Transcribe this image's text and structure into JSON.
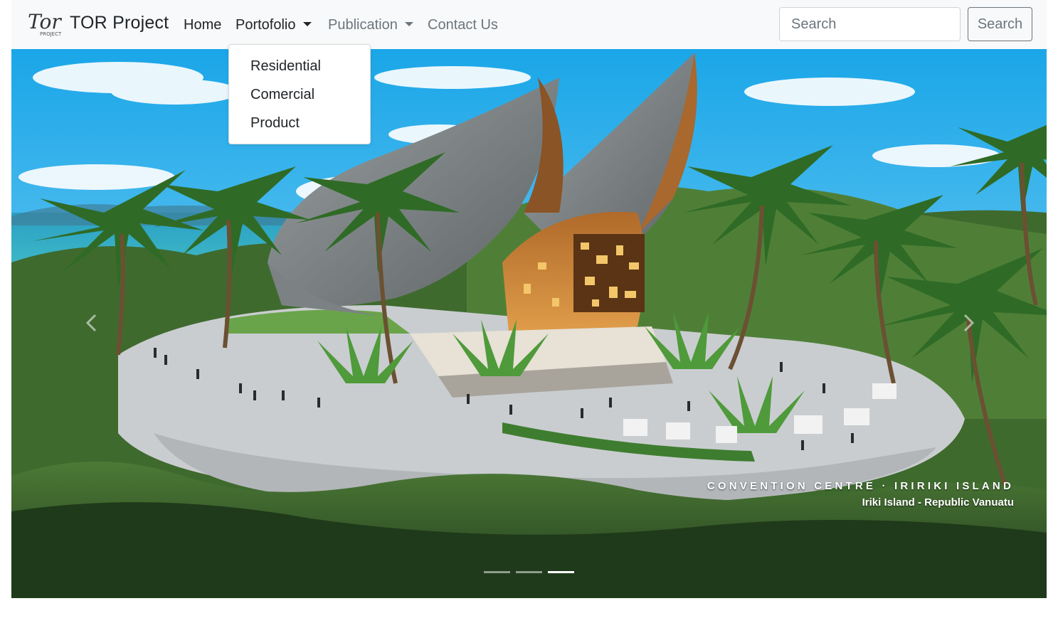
{
  "navbar": {
    "brand_logo_text": "Tor",
    "brand_logo_sub": "PROJECT",
    "brand_name": "TOR Project",
    "links": [
      {
        "label": "Home"
      },
      {
        "label": "Portofolio"
      },
      {
        "label": "Publication"
      },
      {
        "label": "Contact Us"
      }
    ],
    "search": {
      "placeholder": "Search",
      "button_label": "Search"
    }
  },
  "dropdown": {
    "items": [
      {
        "label": "Residential"
      },
      {
        "label": "Comercial"
      },
      {
        "label": "Product"
      }
    ]
  },
  "carousel": {
    "caption_title": "CONVENTION CENTRE · IRIRIKI ISLAND",
    "caption_subtitle": "Iriki Island - Republic Vanuatu",
    "slide_count": 3,
    "active_slide": 3
  },
  "colors": {
    "navbar_bg": "#f8f9fa",
    "text_dark": "#212529",
    "text_muted": "#6c757d",
    "input_border": "#ced4da"
  },
  "icons": {
    "prev": "chevron-left-icon",
    "next": "chevron-right-icon",
    "caret": "caret-down-icon"
  }
}
